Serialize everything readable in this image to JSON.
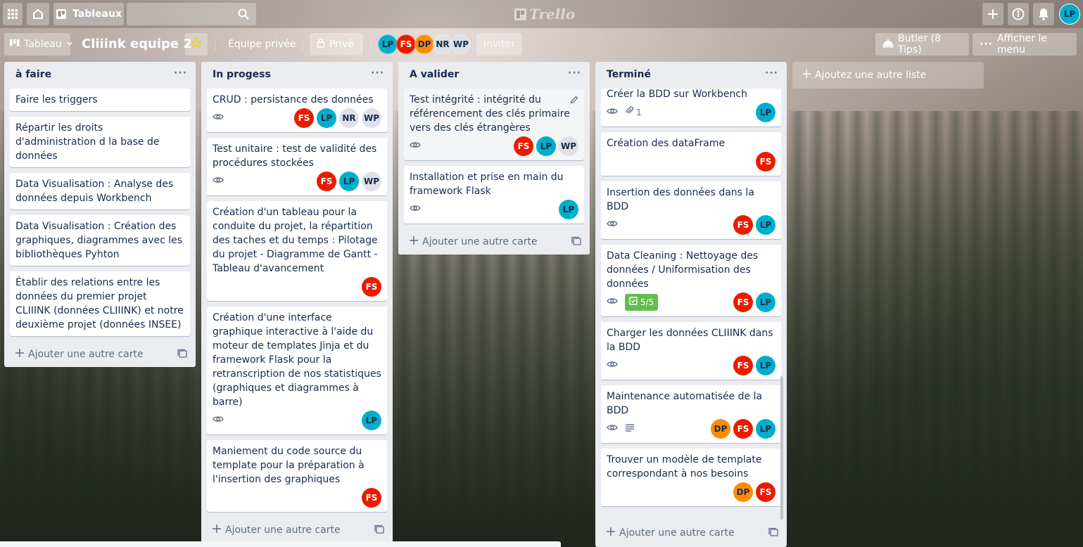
{
  "topbar": {
    "boards_label": "Tableaux",
    "logo_text": "Trello",
    "user_initials": "LP"
  },
  "board": {
    "view_label": "Tableau",
    "title": "Cliiink equipe 2",
    "team_label": "Équipe privée",
    "privacy_label": "Privé",
    "members": [
      "LP",
      "FS",
      "DP",
      "NR",
      "WP"
    ],
    "invite_label": "Inviter",
    "butler_label": "Butler (8 Tips)",
    "menu_label": "Afficher le menu",
    "add_list_label": "Ajoutez une autre liste"
  },
  "lists": [
    {
      "title": "à faire",
      "add_card_label": "Ajouter une autre carte",
      "cards": [
        {
          "title": "Faire les triggers"
        },
        {
          "title": "Répartir les droits d'administration d la base de données"
        },
        {
          "title": "Data Visualisation : Analyse des données depuis Workbench"
        },
        {
          "title": "Data Visualisation : Création des graphiques, diagrammes avec les bibliothèques Pyhton"
        },
        {
          "title": "Établir des relations entre les données du premier projet CLIIINK (données CLIIINK) et notre deuxième projet (données INSEE)"
        }
      ]
    },
    {
      "title": "In progess",
      "add_card_label": "Ajouter une autre carte",
      "cards": [
        {
          "title": "CRUD : persistance des données",
          "watch": true,
          "members": [
            "FS",
            "LP",
            "NR",
            "WP"
          ]
        },
        {
          "title": "Test unitaire : test de validité des procédures stockées",
          "watch": true,
          "members": [
            "FS",
            "LP",
            "WP"
          ]
        },
        {
          "title": "Création d'un tableau pour la conduite du projet, la répartition des taches et du temps : Pilotage du projet - Diagramme de Gantt - Tableau d'avancement",
          "members": [
            "FS"
          ]
        },
        {
          "title": "Création d'une interface graphique interactive à l'aide du moteur de templates Jinja et du framework Flask pour la retranscription de nos statistiques (graphiques et diagrammes à barre)",
          "watch": true,
          "members": [
            "LP"
          ]
        },
        {
          "title": "Maniement du code source du template pour la préparation à l'insertion des graphiques",
          "members": [
            "FS"
          ]
        }
      ]
    },
    {
      "title": "A valider",
      "add_card_label": "Ajouter une autre carte",
      "cards": [
        {
          "title": "Test intégrité : intégrité du référencement des clés primaire vers des clés étrangères",
          "watch": true,
          "members": [
            "FS",
            "LP",
            "WP"
          ],
          "editing": true
        },
        {
          "title": "Installation et prise en main du framework Flask",
          "watch": true,
          "members": [
            "LP"
          ]
        }
      ]
    },
    {
      "title": "Terminé",
      "add_card_label": "Ajouter une autre carte",
      "cards": [
        {
          "title": "Créer la BDD sur Workbench",
          "watch": true,
          "attachments": "1",
          "members": [
            "LP"
          ]
        },
        {
          "title": "Création des dataFrame",
          "members": [
            "FS"
          ]
        },
        {
          "title": "Insertion des données dans la BDD",
          "watch": true,
          "members": [
            "FS",
            "LP"
          ]
        },
        {
          "title": "Data Cleaning : Nettoyage des données / Uniformisation des données",
          "watch": true,
          "checklist": "5/5",
          "members": [
            "FS",
            "LP"
          ]
        },
        {
          "title": "Charger les données CLIIINK dans la BDD",
          "watch": true,
          "members": [
            "FS",
            "LP"
          ]
        },
        {
          "title": "Maintenance automatisée de la BDD",
          "watch": true,
          "description": true,
          "members": [
            "DP",
            "FS",
            "LP"
          ]
        },
        {
          "title": "Trouver un modèle de template correspondant à nos besoins",
          "members": [
            "DP",
            "FS"
          ]
        }
      ]
    }
  ],
  "colors": {
    "LP": "#00aecc",
    "FS": "#eb1b00",
    "DP": "#ff8c00",
    "NR": "#dfe1e6",
    "WP": "#dfe1e6",
    "checklist_complete": "#61bd4f",
    "star": "#f2d600"
  }
}
